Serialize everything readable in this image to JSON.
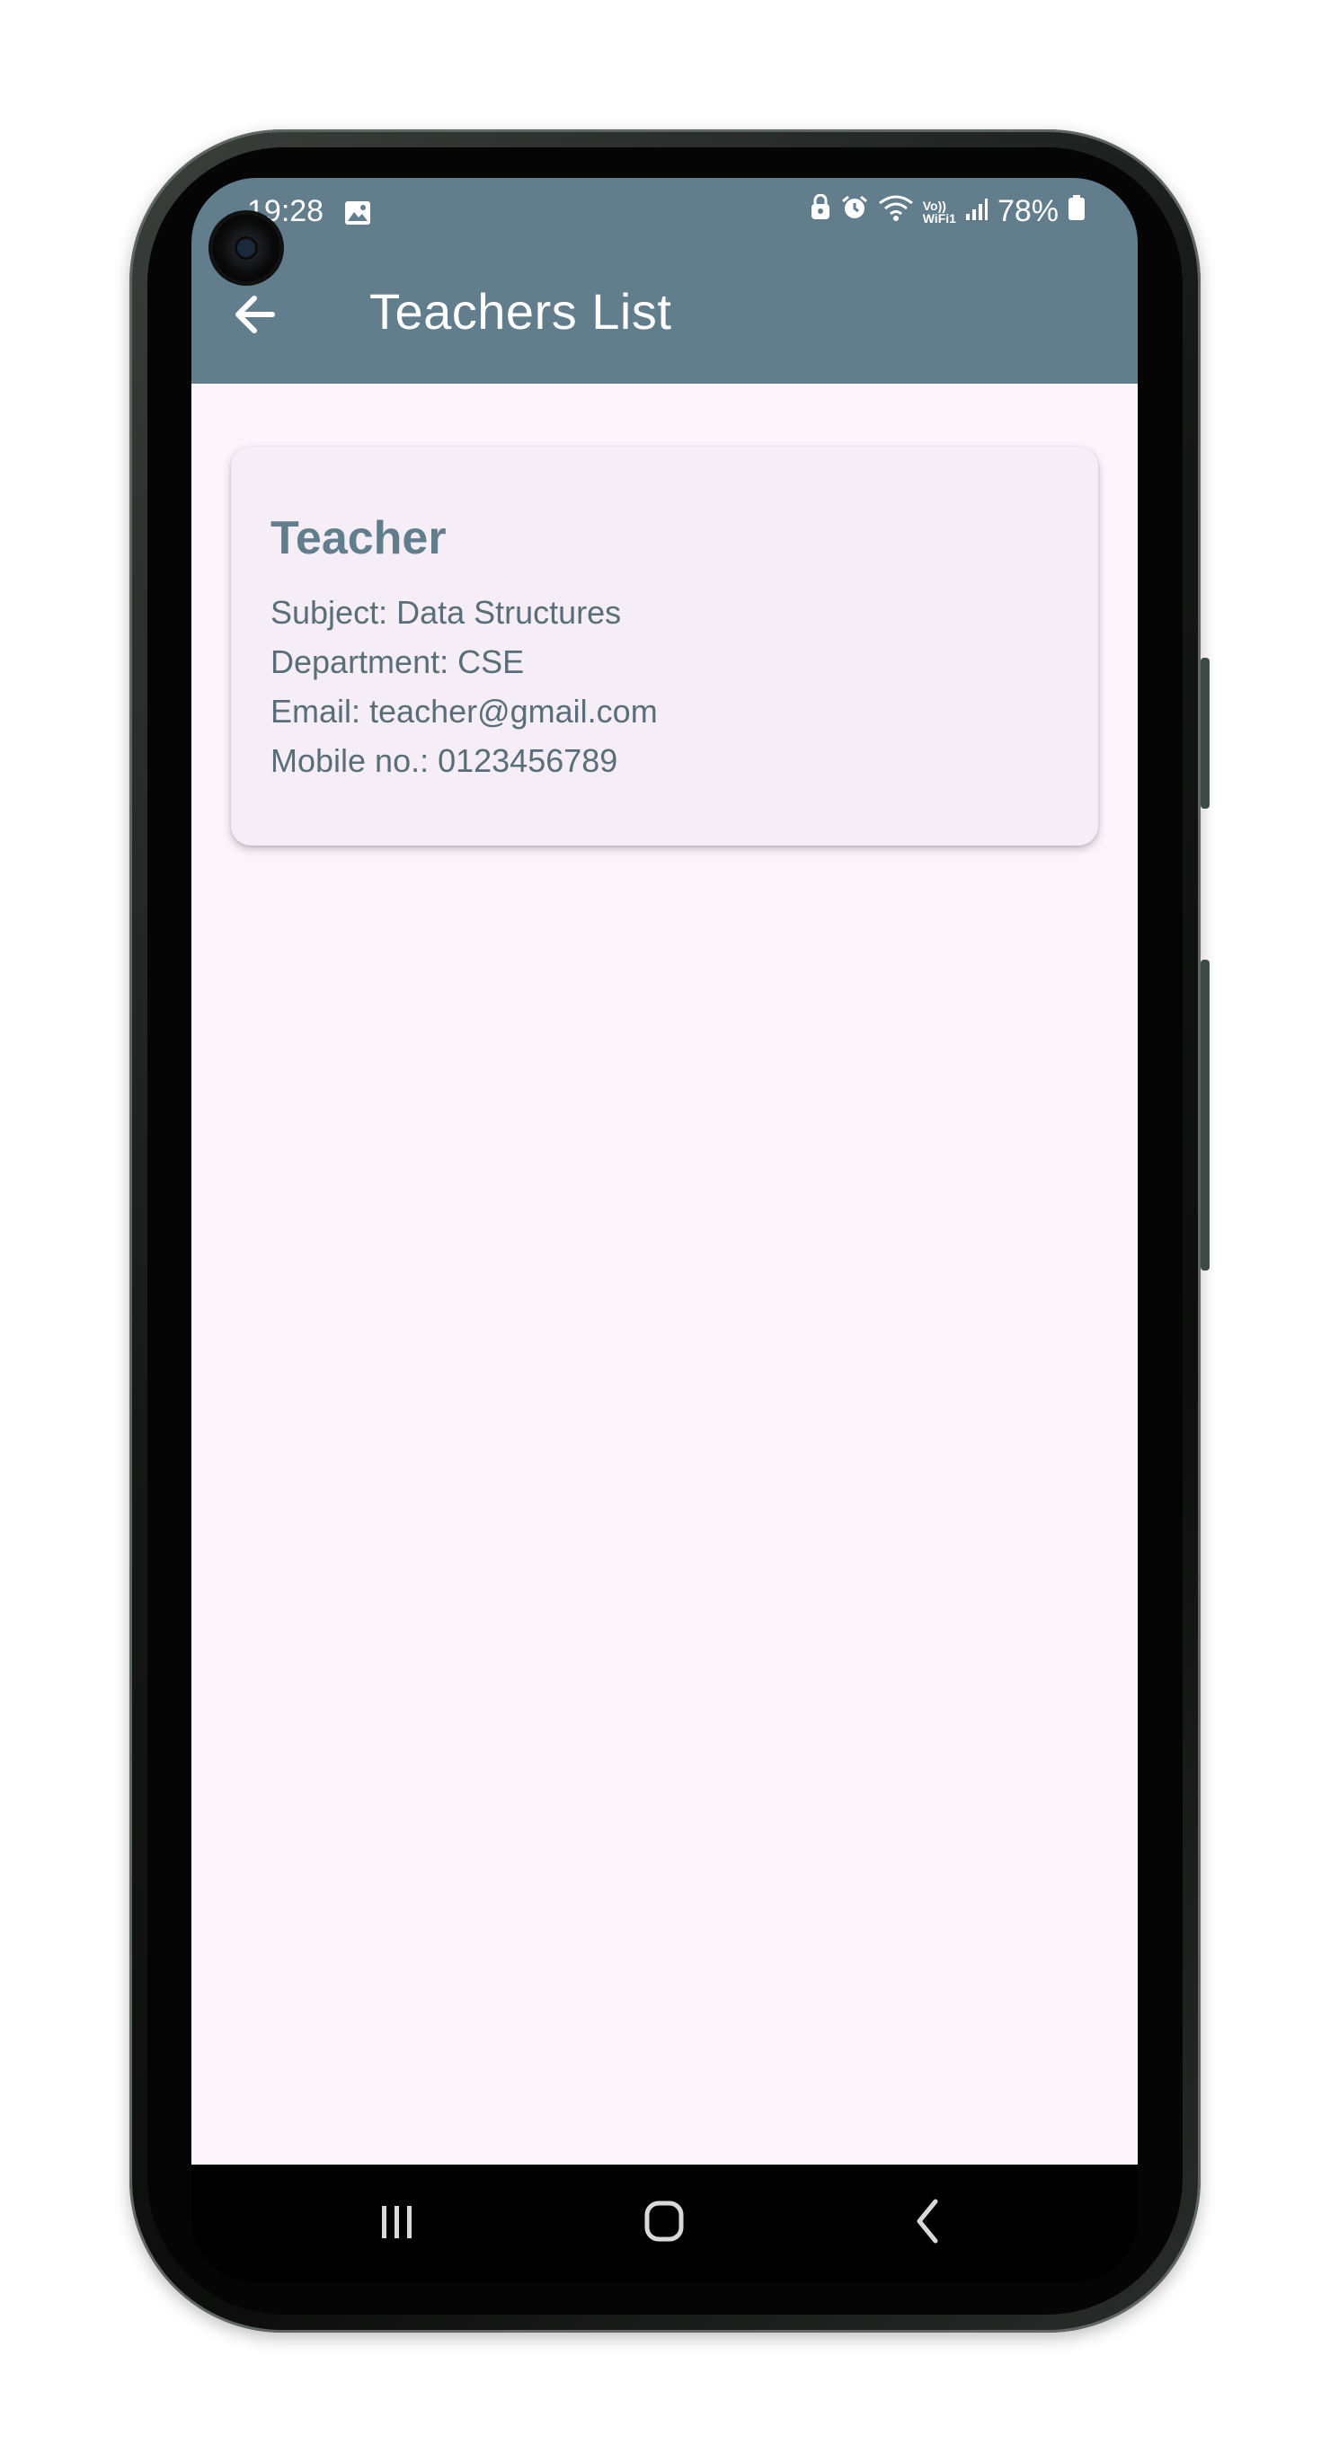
{
  "status_bar": {
    "time": "19:28",
    "battery": "78%",
    "network_label_top": "Vo))",
    "network_label_bottom": "WiFi1"
  },
  "app_bar": {
    "title": "Teachers List",
    "back_icon": "arrow-left-icon"
  },
  "teachers": [
    {
      "name": "Teacher",
      "subject": "Subject: Data Structures",
      "department": "Department: CSE",
      "email": "Email: teacher@gmail.com",
      "mobile": "Mobile no.: 0123456789"
    }
  ],
  "nav_bar": {
    "recents_icon": "recents-icon",
    "home_icon": "home-icon",
    "back_icon": "chevron-left-icon"
  },
  "colors": {
    "app_bar": "#627d8b",
    "background": "#fcf5fc",
    "card": "#f5eef6",
    "card_title": "#627d8b",
    "card_text": "#5a6e79"
  }
}
